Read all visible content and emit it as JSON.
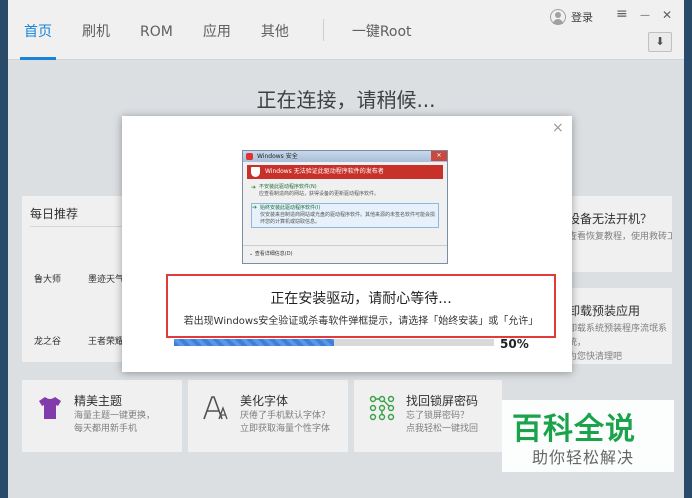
{
  "nav": {
    "tabs": [
      "首页",
      "刷机",
      "ROM",
      "应用",
      "其他"
    ],
    "active_tab": "首页",
    "root_tab": "一键Root"
  },
  "header": {
    "login_label": "登录",
    "menu_glyph": "≡",
    "minimize_glyph": "—",
    "close_glyph": "✕",
    "download_glyph": "⬇"
  },
  "status_text": "正在连接，请稍候...",
  "daily": {
    "title": "每日推荐",
    "apps": [
      "鲁大师",
      "墨迹天气",
      "龙之谷",
      "王者荣耀"
    ]
  },
  "right_cards": [
    {
      "title": "设备无法开机？",
      "desc": "查看恢复教程，使用救砖工"
    },
    {
      "title": "卸载预装应用",
      "desc": "卸载系统预装程序流氓系统，\n为您快清理吧"
    }
  ],
  "bottom_cards": [
    {
      "title": "精美主题",
      "desc": "海量主题一键更换，\n每天都用新手机",
      "icon": "tshirt-icon",
      "color": "#8b3fb5"
    },
    {
      "title": "美化字体",
      "desc": "厌倦了手机默认字体？\n立即获取海量个性字体",
      "icon": "font-icon",
      "color": "#555555"
    },
    {
      "title": "找回锁屏密码",
      "desc": "忘了锁屏密码？\n点我轻松一键找回",
      "icon": "pattern-lock-icon",
      "color": "#3caa4a"
    }
  ],
  "modal": {
    "close_glyph": "×",
    "windows_dialog": {
      "title": "Windows 安全",
      "header": "Windows 无法验证此驱动程序软件的发布者",
      "option1_title": "不安装此驱动程序软件(N)",
      "option1_desc": "应查看制造商的网站，获得设备的更新驱动程序软件。",
      "option2_title": "始终安装此驱动程序软件(I)",
      "option2_desc": "仅安装来自制造商网站或光盘的驱动程序软件。其他来源的未签名软件可能会损坏您的计算机或窃取信息。",
      "more": "查看详细信息(D)"
    },
    "notice_title": "正在安装驱动，请耐心等待...",
    "notice_desc": "若出现Windows安全验证或杀毒软件弹框提示，请选择「始终安装」或「允许」",
    "progress_percent": 50,
    "progress_label": "50%"
  },
  "watermark": {
    "line1": "百科全说",
    "line2": "助你轻松解决"
  }
}
